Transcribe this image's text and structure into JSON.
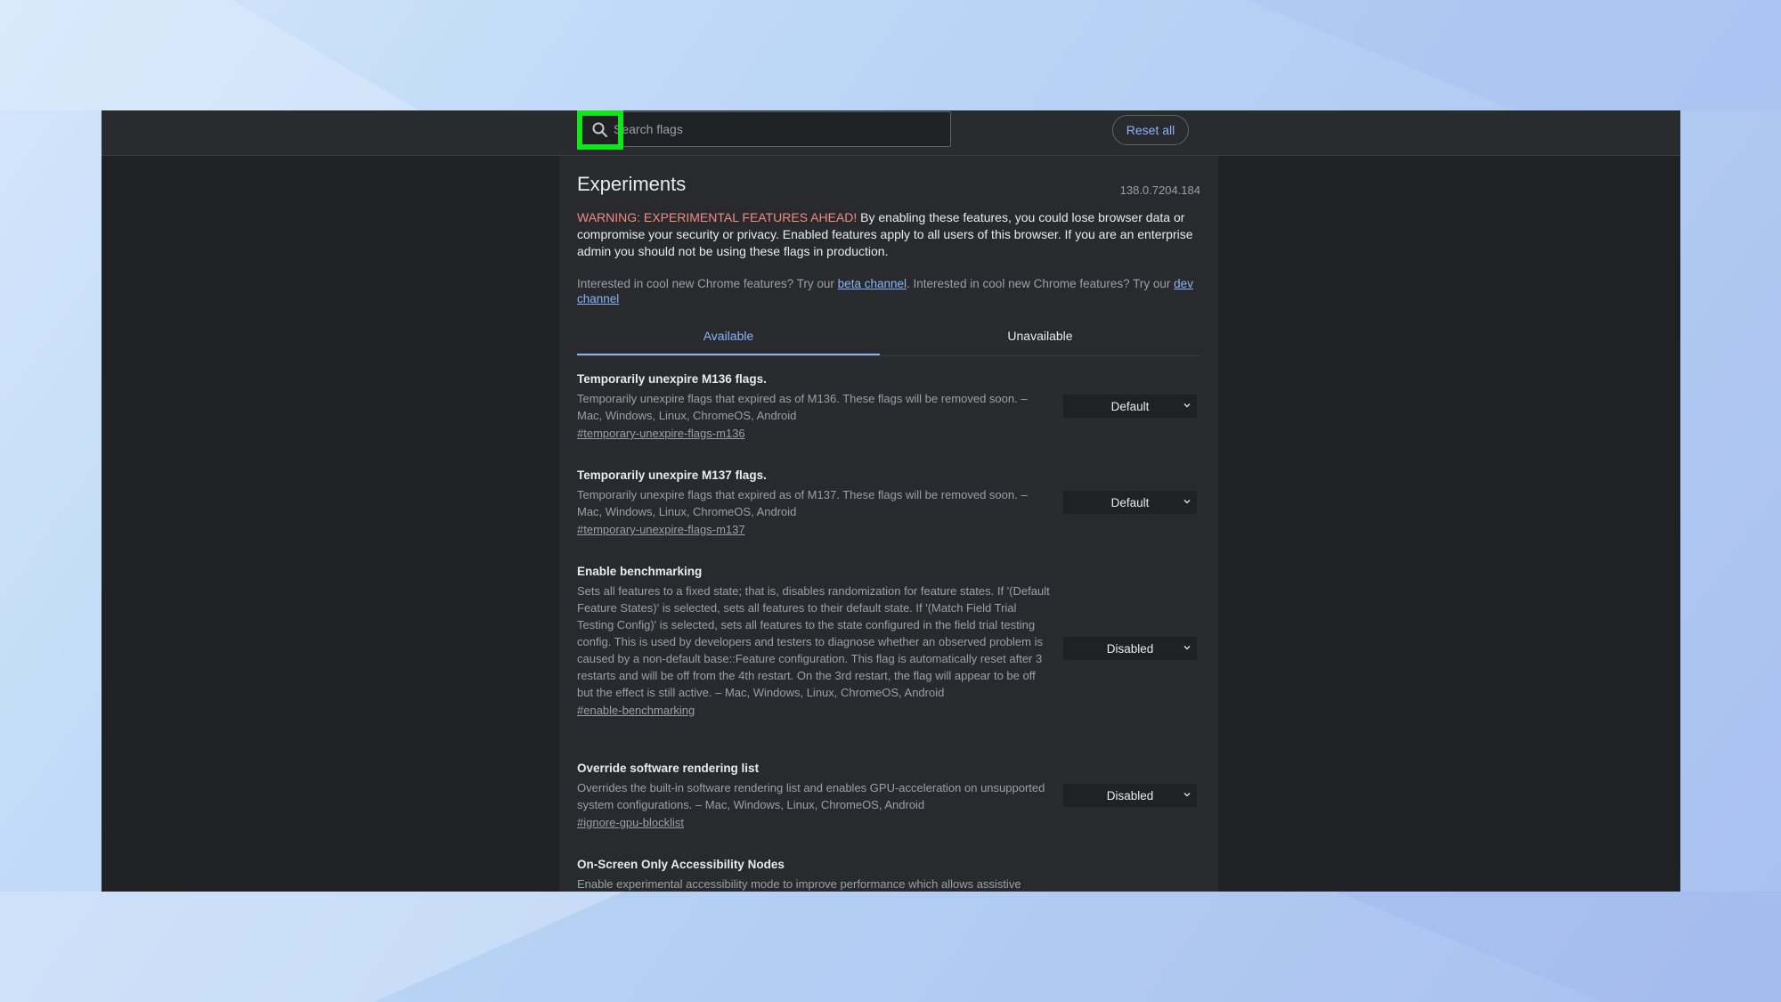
{
  "search": {
    "placeholder": "Search flags"
  },
  "header": {
    "reset_label": "Reset all"
  },
  "page": {
    "title": "Experiments",
    "version": "138.0.7204.184",
    "warning_strong": "WARNING: EXPERIMENTAL FEATURES AHEAD!",
    "warning_text": "By enabling these features, you could lose browser data or compromise your security or privacy. Enabled features apply to all users of this browser. If you are an enterprise admin you should not be using these flags in production.",
    "promo_text_1": "Interested in cool new Chrome features? Try our",
    "promo_link_1": "beta channel",
    "promo_text_2": ". Interested in cool new Chrome features? Try our",
    "promo_link_2": "dev channel"
  },
  "tabs": [
    {
      "label": "Available",
      "active": true
    },
    {
      "label": "Unavailable",
      "active": false
    }
  ],
  "flags": [
    {
      "title": "Temporarily unexpire M136 flags.",
      "description": "Temporarily unexpire flags that expired as of M136. These flags will be removed soon. – Mac, Windows, Linux, ChromeOS, Android",
      "link": "#temporary-unexpire-flags-m136",
      "value": "Default"
    },
    {
      "title": "Temporarily unexpire M137 flags.",
      "description": "Temporarily unexpire flags that expired as of M137. These flags will be removed soon. – Mac, Windows, Linux, ChromeOS, Android",
      "link": "#temporary-unexpire-flags-m137",
      "value": "Default"
    },
    {
      "title": "Enable benchmarking",
      "description": "Sets all features to a fixed state; that is, disables randomization for feature states. If '(Default Feature States)' is selected, sets all features to their default state. If '(Match Field Trial Testing Config)' is selected, sets all features to the state configured in the field trial testing config. This is used by developers and testers to diagnose whether an observed problem is caused by a non-default base::Feature configuration. This flag is automatically reset after 3 restarts and will be off from the 4th restart. On the 3rd restart, the flag will appear to be off but the effect is still active. – Mac, Windows, Linux, ChromeOS, Android",
      "link": "#enable-benchmarking",
      "value": "Disabled"
    },
    {
      "title": "Override software rendering list",
      "description": "Overrides the built-in software rendering list and enables GPU-acceleration on unsupported system configurations. – Mac, Windows, Linux, ChromeOS, Android",
      "link": "#ignore-gpu-blocklist",
      "value": "Disabled"
    },
    {
      "title": "On-Screen Only Accessibility Nodes",
      "description": "Enable experimental accessibility mode to improve performance which allows assistive",
      "link": "",
      "value": ""
    }
  ],
  "colors": {
    "highlight": "#11e61a",
    "accent": "#8ab4f8",
    "warning": "#f28b82"
  }
}
